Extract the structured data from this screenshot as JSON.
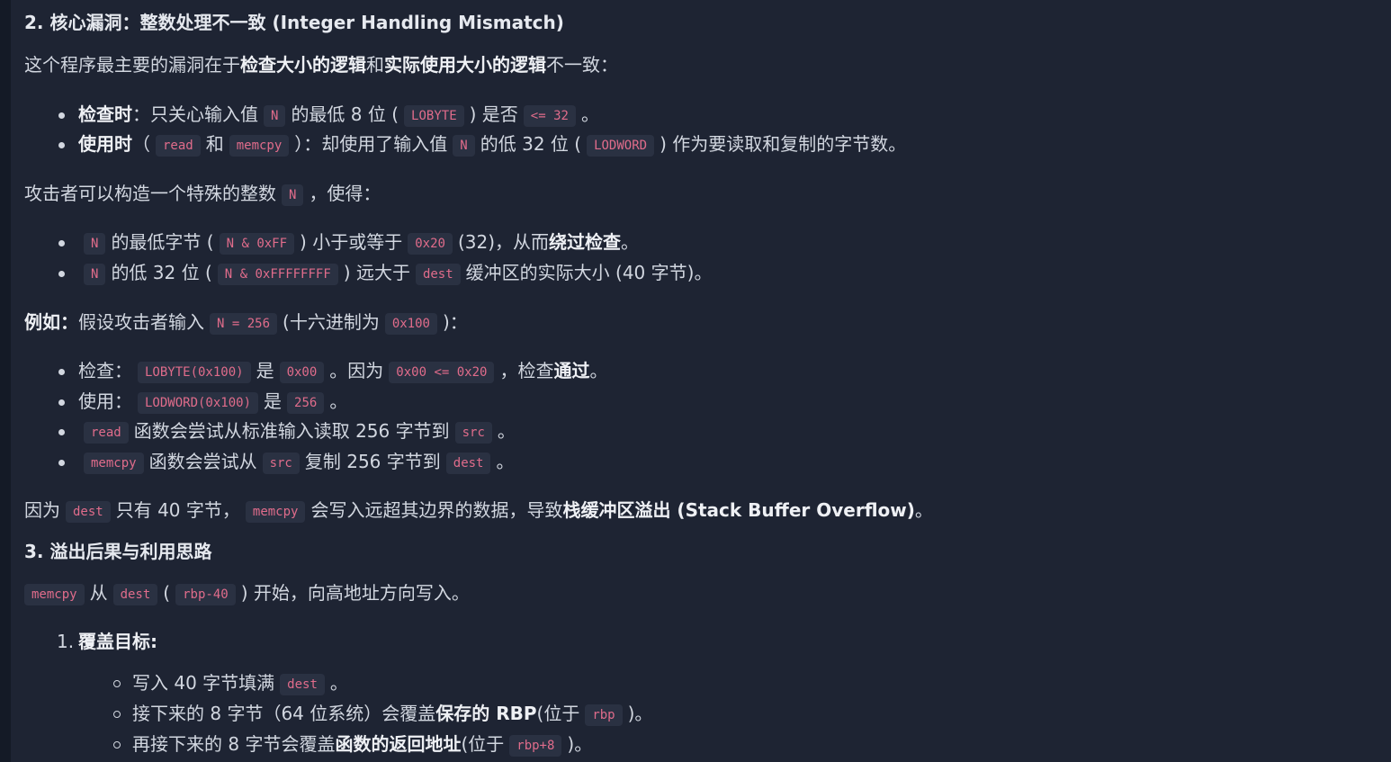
{
  "section2": {
    "heading": "2. 核心漏洞：整数处理不一致 (Integer Handling Mismatch)",
    "intro": {
      "t1": "这个程序最主要的漏洞在于",
      "b1": "检查大小的逻辑",
      "t2": "和",
      "b2": "实际使用大小的逻辑",
      "t3": "不一致："
    },
    "bullets1": {
      "check": {
        "b": "检查时",
        "t1": "：只关心输入值",
        "c1": "N",
        "t2": "的最低 8 位 (",
        "c2": "LOBYTE",
        "t3": ") 是否",
        "c3": "<= 32",
        "t4": "。"
      },
      "use": {
        "b": "使用时",
        "t1": "（",
        "c1": "read",
        "t2": "和",
        "c2": "memcpy",
        "t3": "）：却使用了输入值",
        "c3": "N",
        "t4": "的低 32 位 (",
        "c4": "LODWORD",
        "t5": ") 作为要读取和复制的字节数。"
      }
    },
    "attacker": {
      "t1": "攻击者可以构造一个特殊的整数",
      "c1": "N",
      "t2": "，使得："
    },
    "bullets2": {
      "low": {
        "c1": "N",
        "t1": "的最低字节 (",
        "c2": "N & 0xFF",
        "t2": ") 小于或等于",
        "c3": "0x20",
        "t3": "(32)，从而",
        "b": "绕过检查",
        "t4": "。"
      },
      "high": {
        "c1": "N",
        "t1": "的低 32 位 (",
        "c2": "N & 0xFFFFFFFF",
        "t2": ") 远大于",
        "c3": "dest",
        "t3": "缓冲区的实际大小 (40 字节)。"
      }
    },
    "example": {
      "b": "例如：",
      "t1": "假设攻击者输入",
      "c1": "N = 256",
      "t2": "(十六进制为",
      "c2": "0x100",
      "t3": ")："
    },
    "bullets3": {
      "check": {
        "t1": "检查：",
        "c1": "LOBYTE(0x100)",
        "t2": "是",
        "c2": "0x00",
        "t3": "。因为",
        "c3": "0x00 <= 0x20",
        "t4": "，检查",
        "b": "通过",
        "t5": "。"
      },
      "use": {
        "t1": "使用：",
        "c1": "LODWORD(0x100)",
        "t2": "是",
        "c2": "256",
        "t3": "。"
      },
      "read": {
        "c1": "read",
        "t1": "函数会尝试从标准输入读取 256 字节到",
        "c2": "src",
        "t2": "。"
      },
      "memcpy": {
        "c1": "memcpy",
        "t1": "函数会尝试从",
        "c2": "src",
        "t2": "复制 256 字节到",
        "c3": "dest",
        "t3": "。"
      }
    },
    "conclusion": {
      "t1": "因为",
      "c1": "dest",
      "t2": "只有 40 字节，",
      "c2": "memcpy",
      "t3": "会写入远超其边界的数据，导致",
      "b": "栈缓冲区溢出 (Stack Buffer Overflow)",
      "t4": "。"
    }
  },
  "section3": {
    "heading": "3. 溢出后果与利用思路",
    "intro": {
      "c1": "memcpy",
      "t1": "从",
      "c2": "dest",
      "t2": "(",
      "c3": "rbp-40",
      "t3": ") 开始，向高地址方向写入。"
    },
    "ol1": {
      "num": "1.",
      "b": "覆盖目标:"
    },
    "sub": {
      "a": {
        "t1": "写入 40 字节填满",
        "c1": "dest",
        "t2": "。"
      },
      "b": {
        "t1": "接下来的 8 字节（64 位系统）会覆盖",
        "b": "保存的 RBP",
        "t2": "(位于",
        "c1": "rbp",
        "t3": ")。"
      },
      "c": {
        "t1": "再接下来的 8 字节会覆盖",
        "b": "函数的返回地址",
        "t2": "(位于",
        "c1": "rbp+8",
        "t3": ")。"
      }
    }
  }
}
